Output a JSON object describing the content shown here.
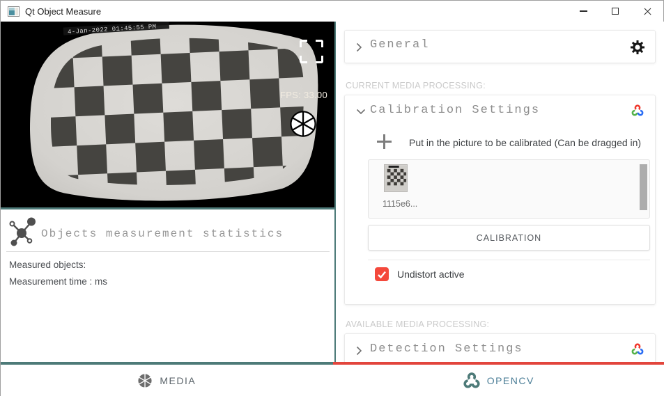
{
  "window": {
    "title": "Qt Object Measure"
  },
  "camera": {
    "timestamp": "4-Jan-2022 01:45:55 PM",
    "fps": "FPS: 33.00"
  },
  "stats": {
    "title": "Objects measurement statistics",
    "measured_objects_label": "Measured objects:",
    "measurement_time_label": "Measurement time : ms"
  },
  "panel": {
    "general_label": "General",
    "current_media_label": "CURRENT MEDIA PROCESSING:",
    "calibration_label": "Calibration Settings",
    "drop_hint": "Put in the picture to be calibrated (Can be dragged in)",
    "thumbnail_name": "1115e6...",
    "calibration_button": "CALIBRATION",
    "undistort_label": "Undistort active",
    "undistort_checked": true,
    "available_media_label": "AVAILABLE MEDIA PROCESSING:",
    "detection_label": "Detection Settings"
  },
  "footer": {
    "media": "MEDIA",
    "opencv": "OPENCV"
  },
  "colors": {
    "teal": "#4d7a78",
    "red_line": "#e2453c",
    "checkbox_red": "#f4493c",
    "opencv_red": "#f0372c",
    "opencv_green": "#55b24a",
    "opencv_blue": "#2a6df4"
  },
  "icons": {
    "app-icon": "window-pane",
    "minimize-icon": "—",
    "maximize-icon": "□",
    "close-icon": "✕",
    "fullscreen-icon": "corner-brackets",
    "shutter-icon": "aperture-blades",
    "gear-icon": "gear",
    "chevron-right-icon": "›",
    "chevron-down-icon": "⌄",
    "plus-icon": "+",
    "opencv-logo": "three C rings (red/green/blue)",
    "molecule-icon": "node-graph",
    "check-icon": "✓"
  }
}
